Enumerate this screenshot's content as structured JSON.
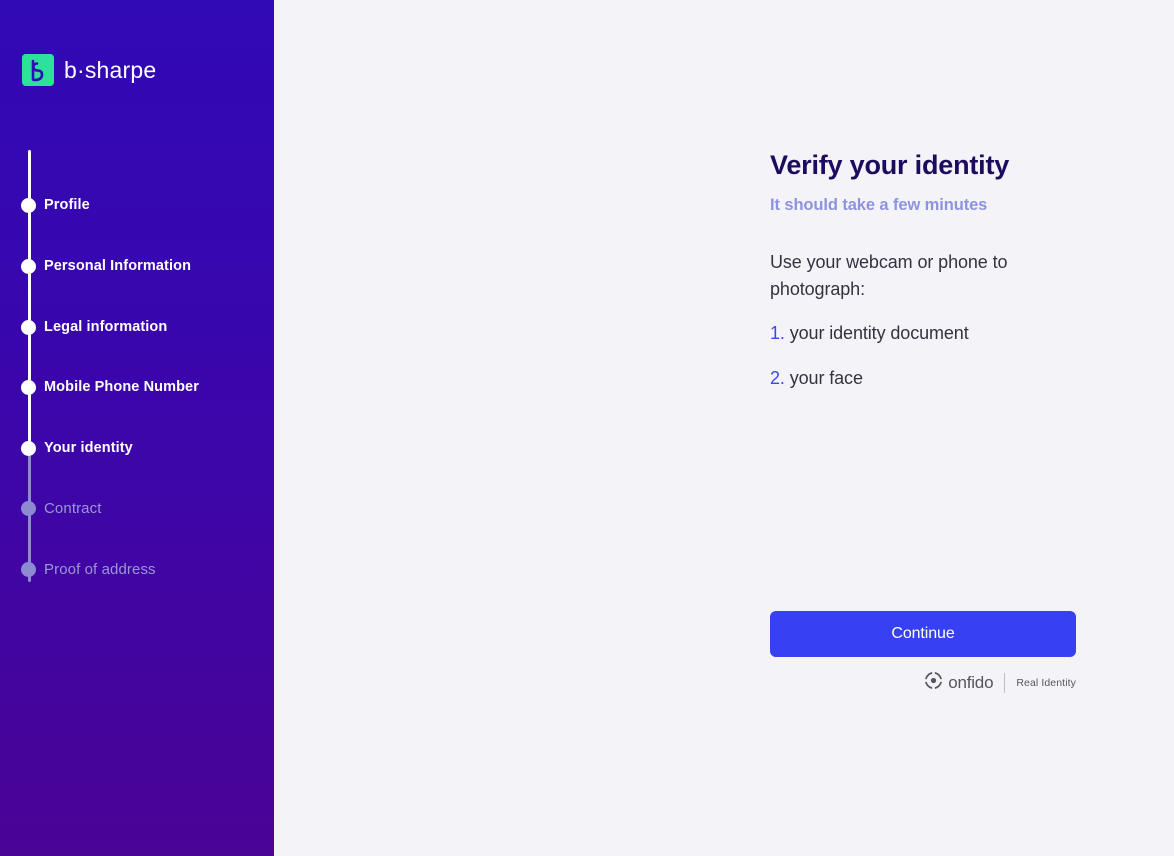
{
  "brand": {
    "name": "b·sharpe",
    "mark_color": "#2ce29a"
  },
  "sidebar": {
    "background_top": "#3109b5",
    "background_bottom": "#4a0496",
    "steps": [
      {
        "label": "Profile",
        "state": "complete"
      },
      {
        "label": "Personal Information",
        "state": "complete"
      },
      {
        "label": "Legal information",
        "state": "complete"
      },
      {
        "label": "Mobile Phone Number",
        "state": "complete"
      },
      {
        "label": "Your identity",
        "state": "current"
      },
      {
        "label": "Contract",
        "state": "pending"
      },
      {
        "label": "Proof of address",
        "state": "pending"
      }
    ]
  },
  "main": {
    "title": "Verify your identity",
    "subtitle": "It should take a few minutes",
    "instruction": "Use your webcam or phone to photograph:",
    "photo_items": [
      {
        "number": "1.",
        "text": "your identity document"
      },
      {
        "number": "2.",
        "text": "your face"
      }
    ],
    "continue_label": "Continue",
    "accent_color": "#3740f2",
    "title_color": "#1e0a5e",
    "subtitle_color": "#8e93e0"
  },
  "footer": {
    "provider": "onfido",
    "tagline": "Real Identity"
  }
}
